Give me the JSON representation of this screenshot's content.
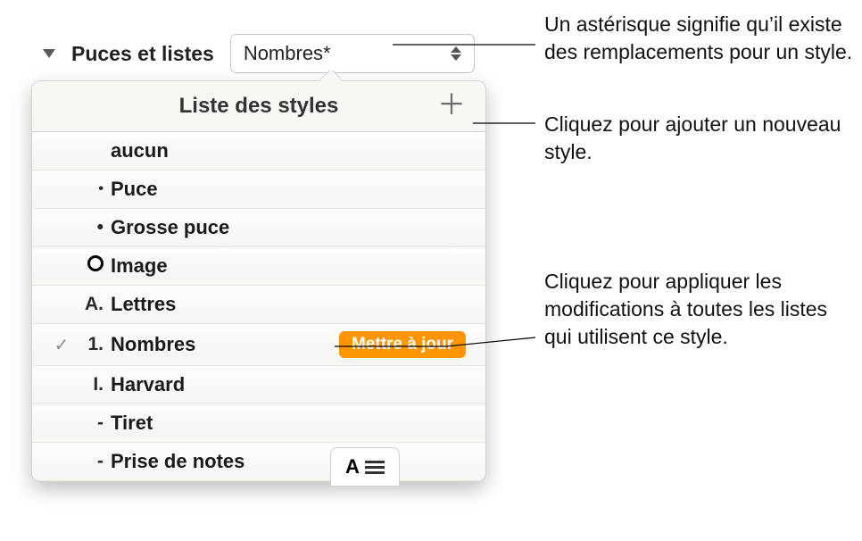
{
  "section_label": "Puces et listes",
  "select_value": "Nombres*",
  "popover_title": "Liste des styles",
  "update_label": "Mettre à jour",
  "styles": {
    "none": "aucun",
    "bullet": "Puce",
    "big_bullet": "Grosse puce",
    "image": "Image",
    "letters": "Lettres",
    "numbers": "Nombres",
    "harvard": "Harvard",
    "dash": "Tiret",
    "notes": "Prise de notes"
  },
  "markers": {
    "bullet": "•",
    "big_bullet": "•",
    "letters": "A.",
    "numbers": "1.",
    "harvard": "I.",
    "dash": "-",
    "notes": "-"
  },
  "annotations": {
    "asterisk": "Un astérisque signifie qu’il existe des remplacements pour un style.",
    "add": "Cliquez pour ajouter un nouveau style.",
    "update": "Cliquez pour appliquer les modifications à toutes les listes qui utilisent ce style."
  }
}
